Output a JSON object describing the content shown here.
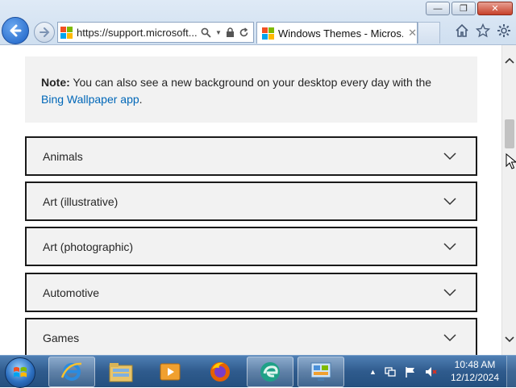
{
  "browser": {
    "address_url": "https://support.microsoft....",
    "tab_title": "Windows Themes - Micros...",
    "tab_close": "✕"
  },
  "window_controls": {
    "minimize": "—",
    "maximize": "❐",
    "close": "✕"
  },
  "note": {
    "label": "Note:",
    "text": " You can also see a new background on your desktop every day with the",
    "link": "Bing Wallpaper app",
    "end": "."
  },
  "accordion": [
    {
      "label": "Animals"
    },
    {
      "label": "Art (illustrative)"
    },
    {
      "label": "Art (photographic)"
    },
    {
      "label": "Automotive"
    },
    {
      "label": "Games"
    }
  ],
  "taskbar": {
    "apps": [
      "internet-explorer",
      "file-explorer",
      "media-player",
      "firefox",
      "edge",
      "control-panel"
    ],
    "clock_time": "10:48 AM",
    "clock_date": "12/12/2024"
  },
  "colors": {
    "link": "#0067b8",
    "accordion_bg": "#f2f2f2",
    "accordion_border": "#1a1a1a",
    "ms_red": "#f25022",
    "ms_green": "#7fba00",
    "ms_blue": "#00a4ef",
    "ms_yellow": "#ffb900"
  }
}
